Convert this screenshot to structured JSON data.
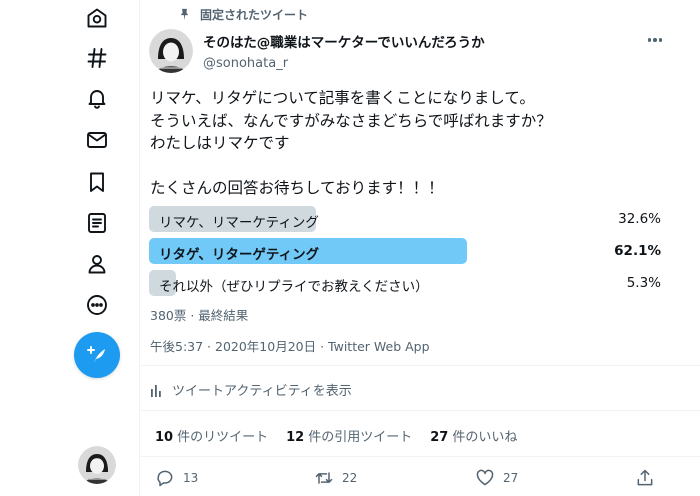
{
  "pinned_label": "固定されたツイート",
  "author": {
    "display_name": "そのはた@職業はマーケターでいいんだろうか",
    "handle": "@sonohata_r"
  },
  "tweet_text": "リマケ、リタゲについて記事を書くことになりまして。\nそういえば、なんですがみなさまどちらで呼ばれますか？\nわたしはリマケです\n\nたくさんの回答お待ちしております！！！",
  "poll": {
    "options": [
      {
        "label": "リマケ、リマーケティング",
        "percent_text": "32.6%",
        "percent": 32.6,
        "winner": false
      },
      {
        "label": "リタゲ、リターゲティング",
        "percent_text": "62.1%",
        "percent": 62.1,
        "winner": true
      },
      {
        "label": "それ以外（ぜひリプライでお教えください）",
        "percent_text": "5.3%",
        "percent": 5.3,
        "winner": false
      }
    ],
    "meta": "380票 · 最終結果"
  },
  "timestamp": "午後5:37 · 2020年10月20日 · Twitter Web App",
  "activity_label": "ツイートアクティビティを表示",
  "stats": {
    "retweets_count": "10",
    "retweets_label": "件のリツイート",
    "quotes_count": "12",
    "quotes_label": "件の引用ツイート",
    "likes_count": "27",
    "likes_label": "件のいいね"
  },
  "actions": {
    "reply_count": "13",
    "retweet_count": "22",
    "like_count": "27"
  },
  "colors": {
    "accent": "#1d9bf0",
    "poll_winner": "#71c9f8",
    "poll_other": "#cfd9de",
    "secondary_text": "#536471"
  }
}
